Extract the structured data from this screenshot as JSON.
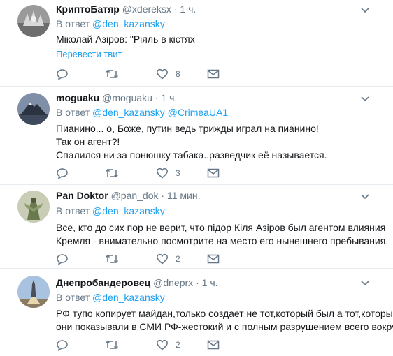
{
  "tweets": [
    {
      "name": "КриптоБатяр",
      "handle": "@xdereksx",
      "dot": "·",
      "time": "1 ч.",
      "reply_prefix": "В ответ",
      "mentions": [
        "@den_kazansky"
      ],
      "lines": [
        "Мiколай Азiров: \"Рiяль в кiстях"
      ],
      "translate": "Перевести твит",
      "likes": "8"
    },
    {
      "name": "moguaku",
      "handle": "@moguaku",
      "dot": "·",
      "time": "1 ч.",
      "reply_prefix": "В ответ",
      "mentions": [
        "@den_kazansky",
        "@CrimeaUA1"
      ],
      "lines": [
        "Пианино... о, Боже, путин ведь трижды играл на пианино!",
        "Так он агент?!",
        "Спалился ни за понюшку табака..разведчик её называется."
      ],
      "likes": "3"
    },
    {
      "name": "Pan Doktor",
      "handle": "@pan_dok",
      "dot": "·",
      "time": "11 мин.",
      "reply_prefix": "В ответ",
      "mentions": [
        "@den_kazansky"
      ],
      "lines": [
        "Все, кто до сих пор не верит, что пiдор Кiля Азiров был агентом влияния",
        "Кремля - внимательно посмотрите на место его нынешнего пребывания."
      ],
      "likes": "2"
    },
    {
      "name": "Днепробандеровец",
      "handle": "@dneprx",
      "dot": "·",
      "time": "1 ч.",
      "reply_prefix": "В ответ",
      "mentions": [
        "@den_kazansky"
      ],
      "lines": [
        "РФ тупо копирует майдан,только создает не тот,который был а тот,который",
        "они показывали в СМИ РФ-жестокий и с полным разрушением всего вокруг."
      ],
      "likes": "2"
    }
  ],
  "icons": {
    "reply": "reply-icon",
    "retweet": "retweet-icon",
    "like": "heart-icon",
    "dm": "envelope-icon",
    "menu": "chevron-down-icon"
  },
  "colors": {
    "link": "#1da1f2",
    "muted": "#657786",
    "text": "#14171a",
    "divider": "#e6ecf0"
  }
}
